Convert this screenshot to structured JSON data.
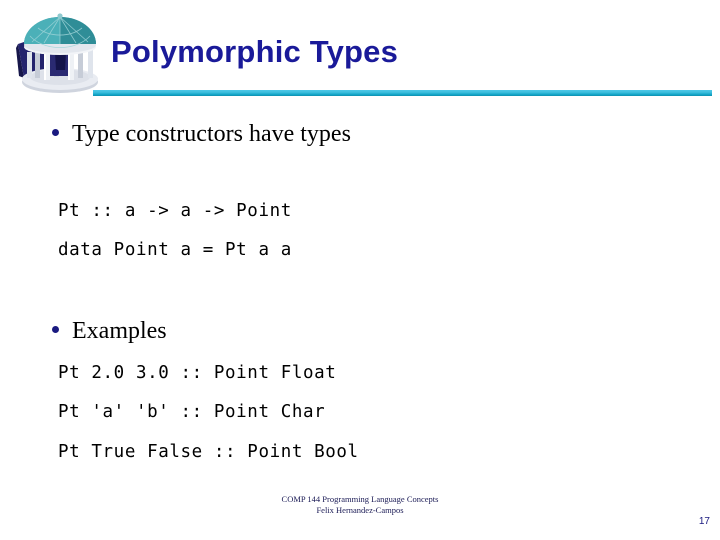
{
  "slide": {
    "title": "Polymorphic Types",
    "accent_title_color": "#1a1a99",
    "rule_color": "#22b3d4",
    "bullet_color": "#1a1a80",
    "background_color": "#ffffff"
  },
  "logo": {
    "name": "old-well-rotunda-logo",
    "dome_color": "#3f9fa8",
    "column_color": "#d8dce4",
    "accent_color": "#1f1f6e"
  },
  "content": {
    "bullets": [
      {
        "text": "Type constructors have types"
      },
      {
        "text": "Examples"
      }
    ],
    "code_block_1": [
      "Pt :: a -> a -> Point",
      "data Point a = Pt a a"
    ],
    "code_block_2": [
      "Pt 2.0 3.0 :: Point Float",
      "Pt 'a' 'b' :: Point Char",
      "Pt True False :: Point Bool"
    ]
  },
  "footer": {
    "course": "COMP 144 Programming Language Concepts",
    "author": "Felix Hernandez-Campos",
    "page_number": "17"
  }
}
